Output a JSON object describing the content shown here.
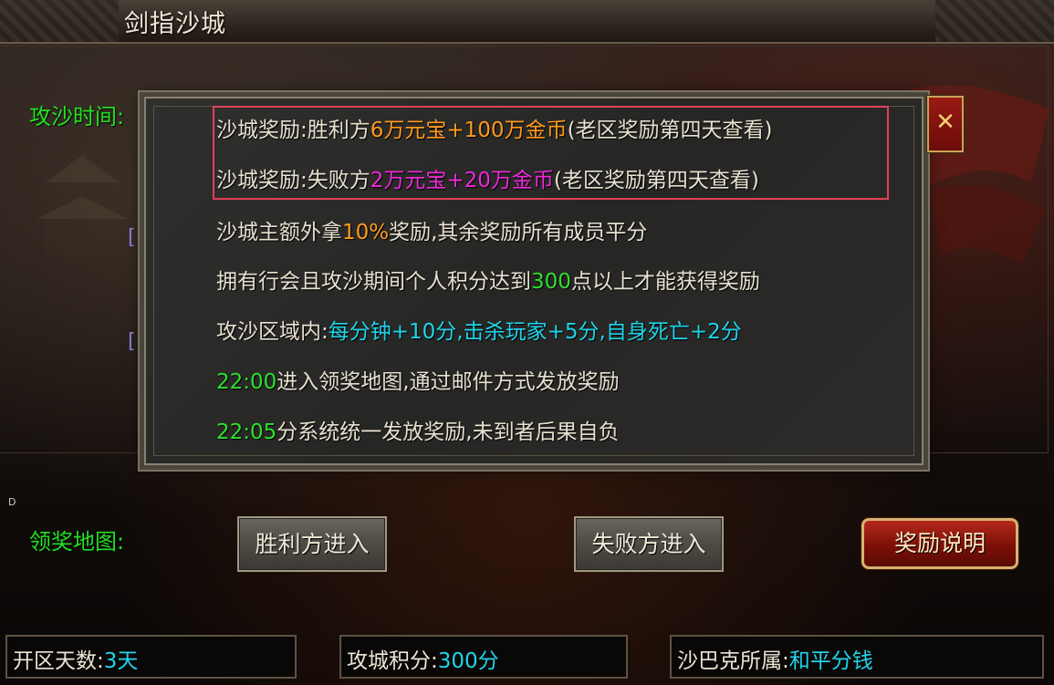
{
  "window": {
    "title": "剑指沙城"
  },
  "main": {
    "time_label": "攻沙时间:",
    "bracket_1": "[",
    "bracket_2": "[",
    "stray_letter": "D"
  },
  "popup": {
    "line1": {
      "prefix": "沙城奖励:胜利方",
      "highlight": "6万元宝+100万金币",
      "suffix": "(老区奖励第四天查看)"
    },
    "line2": {
      "prefix": "沙城奖励:失败方",
      "highlight": "2万元宝+20万金币",
      "suffix": "(老区奖励第四天查看)"
    },
    "line3": {
      "prefix": "沙城主额外拿",
      "highlight": "10%",
      "suffix": "奖励,其余奖励所有成员平分"
    },
    "line4": {
      "prefix": "拥有行会且攻沙期间个人积分达到",
      "highlight": "300",
      "suffix": "点以上才能获得奖励"
    },
    "line5": {
      "prefix": "攻沙区域内:",
      "highlight": "每分钟+10分,击杀玩家+5分,自身死亡+2分"
    },
    "line6": {
      "highlight": "22:00",
      "suffix": "进入领奖地图,通过邮件方式发放奖励"
    },
    "line7": {
      "highlight": "22:05",
      "suffix": "分系统统一发放奖励,未到者后果自负"
    },
    "close_label": "✕"
  },
  "bottom": {
    "map_label": "领奖地图:",
    "winner_button": "胜利方进入",
    "loser_button": "失败方进入",
    "reward_button": "奖励说明"
  },
  "status": {
    "server_days_label": "开区天数:",
    "server_days_value": "3天",
    "siege_points_label": "攻城积分:",
    "siege_points_value": "300分",
    "sabak_owner_label": "沙巴克所属:",
    "sabak_owner_value": "和平分钱"
  },
  "colors": {
    "green": "#2ee02e",
    "orange": "#ff9a1e",
    "magenta": "#ee2ad8",
    "cyan": "#1fd4ea",
    "highlight_border": "#e0405a"
  }
}
